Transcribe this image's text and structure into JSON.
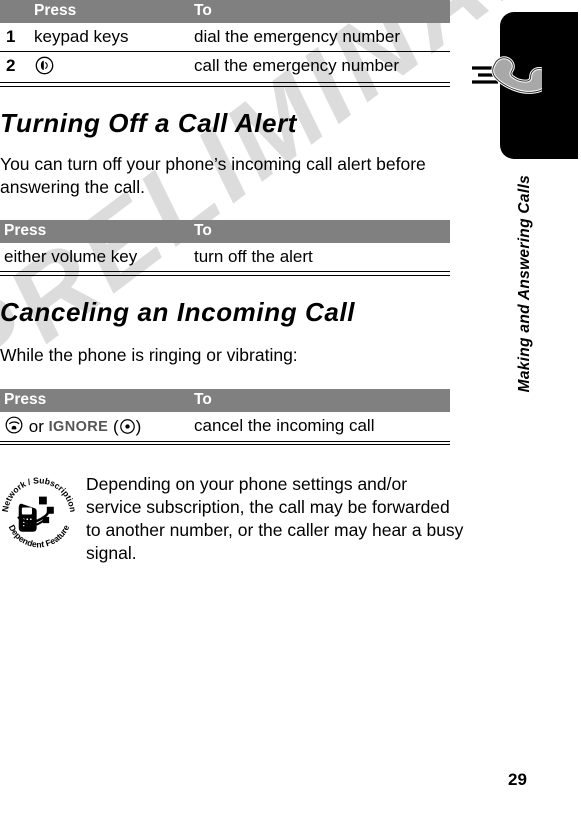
{
  "page": {
    "number": "29",
    "watermark": "PRELIMINARY",
    "accent_gray": "#808080",
    "watermark_color": "#dcdcdc"
  },
  "sidebar": {
    "chapter_title": "Making and Answering Calls",
    "tab_icon": "phone-handset-ringing-icon"
  },
  "tables": [
    {
      "id": "emergency-call-table",
      "numbered": true,
      "headers": {
        "step": "",
        "press": "Press",
        "to": "To"
      },
      "rows": [
        {
          "step": "1",
          "press": "keypad keys",
          "press_glyph": "",
          "to": "dial the emergency number"
        },
        {
          "step": "2",
          "press": "",
          "press_glyph": "send-key-icon",
          "to": "call the emergency number"
        }
      ]
    },
    {
      "id": "turn-off-alert-table",
      "numbered": false,
      "headers": {
        "press": "Press",
        "to": "To"
      },
      "rows": [
        {
          "press": "either volume key",
          "press_glyph": "",
          "to": "turn off the alert"
        }
      ]
    },
    {
      "id": "cancel-incoming-call-table",
      "numbered": false,
      "headers": {
        "press": "Press",
        "to": "To"
      },
      "rows": [
        {
          "press_glyph": "end-key-icon",
          "press_conjunction": "or",
          "press_softkey_label": "IGNORE",
          "press_softkey_glyph": "center-select-key-icon",
          "to": "cancel the incoming call"
        }
      ]
    }
  ],
  "sections": [
    {
      "id": "turning-off-a-call-alert",
      "heading": "Turning Off a Call Alert",
      "body": "You can turn off your phone’s incoming call alert before answering the call."
    },
    {
      "id": "canceling-an-incoming-call",
      "heading": "Canceling an Incoming Call",
      "body": "While the phone is ringing or vibrating:"
    }
  ],
  "note": {
    "icon": "network-subscription-dependent-feature-icon",
    "icon_text_top": "Network / Subscription",
    "icon_text_bottom": "Dependent Feature",
    "text": "Depending on your phone settings and/or service subscription, the call may be forwarded to another number, or the caller may hear a busy signal."
  }
}
